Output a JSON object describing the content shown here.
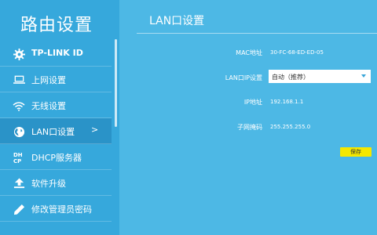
{
  "sidebar": {
    "title": "路由设置",
    "items": [
      {
        "label": "TP-LINK ID",
        "icon": "gear-icon"
      },
      {
        "label": "上网设置",
        "icon": "laptop-icon"
      },
      {
        "label": "无线设置",
        "icon": "wifi-icon"
      },
      {
        "label": "LAN口设置",
        "icon": "globe-icon",
        "active": true,
        "chevron": ">"
      },
      {
        "label": "DHCP服务器",
        "icon": "dhcp-icon"
      },
      {
        "label": "软件升级",
        "icon": "upload-icon"
      },
      {
        "label": "修改管理员密码",
        "icon": "pencil-icon"
      }
    ]
  },
  "main": {
    "title": "LAN口设置",
    "mac_label": "MAC地址",
    "mac_value": "30-FC-68-ED-ED-05",
    "ip_mode_label": "LAN口IP设置",
    "ip_mode_value": "自动（推荐）",
    "ip_label": "IP地址",
    "ip_value": "192.168.1.1",
    "mask_label": "子网掩码",
    "mask_value": "255.255.255.0",
    "save_label": "保存"
  },
  "colors": {
    "background": "#4db8e5",
    "sidebar": "#36a8dc",
    "active_item": "#2a93c8",
    "save_button": "#f5e800"
  }
}
